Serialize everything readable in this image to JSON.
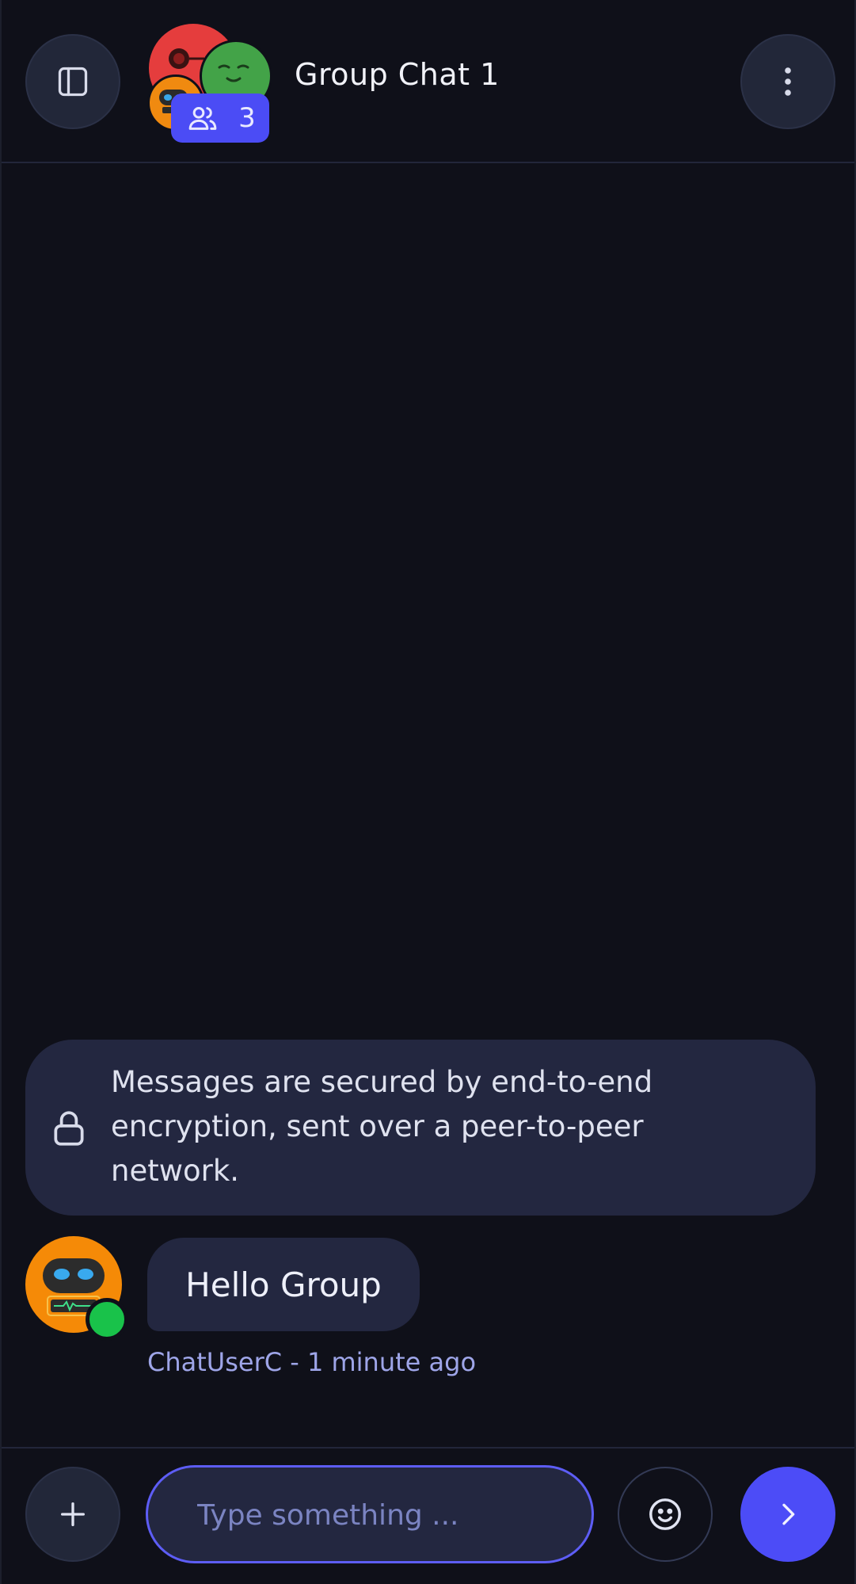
{
  "header": {
    "title": "Group Chat 1",
    "member_count": "3",
    "sidebar_icon": "sidebar-toggle-icon",
    "more_icon": "more-vertical-icon",
    "members_icon": "users-icon"
  },
  "notice": {
    "icon": "lock-icon",
    "text": "Messages are secured by end-to-end encryption, sent over a peer-to-peer network."
  },
  "messages": [
    {
      "text": "Hello Group",
      "author": "ChatUserC",
      "time": "1 minute ago",
      "meta": "ChatUserC - 1 minute ago",
      "status": "online"
    }
  ],
  "composer": {
    "placeholder": "Type something ...",
    "add_icon": "plus-icon",
    "emoji_icon": "smiley-icon",
    "send_icon": "chevron-right-icon"
  },
  "colors": {
    "background": "#0f1019",
    "surface": "#232740",
    "accent": "#4c4cf7",
    "online": "#19c24a",
    "meta_text": "#9ea5e8"
  }
}
